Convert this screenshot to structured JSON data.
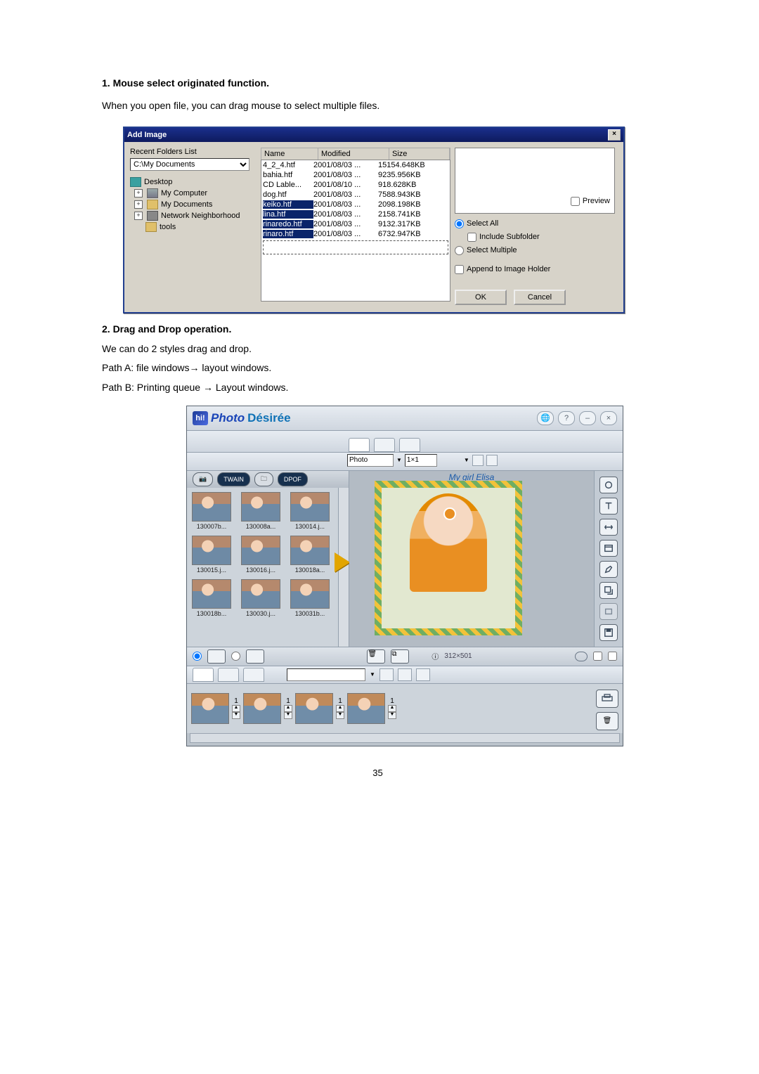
{
  "page_number": "35",
  "section1": {
    "heading": "1.  Mouse select originated function.",
    "para": "When you open file, you can drag mouse to select multiple files."
  },
  "dialog": {
    "title": "Add Image",
    "close": "×",
    "recent_label": "Recent Folders List",
    "recent_value": "C:\\My Documents",
    "tree": {
      "desktop": "Desktop",
      "mycomp": "My Computer",
      "mydocs": "My Documents",
      "netn": "Network Neighborhood",
      "tools": "tools"
    },
    "cols": {
      "name": "Name",
      "modified": "Modified",
      "size": "Size"
    },
    "files": [
      {
        "name": "4_2_4.htf",
        "mod": "2001/08/03 ...",
        "size": "15154.648KB",
        "sel": false
      },
      {
        "name": "bahia.htf",
        "mod": "2001/08/03 ...",
        "size": "9235.956KB",
        "sel": false
      },
      {
        "name": "CD Lable...",
        "mod": "2001/08/10 ...",
        "size": "918.628KB",
        "sel": false
      },
      {
        "name": "dog.htf",
        "mod": "2001/08/03 ...",
        "size": "7588.943KB",
        "sel": false
      },
      {
        "name": "keiko.htf",
        "mod": "2001/08/03 ...",
        "size": "2098.198KB",
        "sel": true
      },
      {
        "name": "lina.htf",
        "mod": "2001/08/03 ...",
        "size": "2158.741KB",
        "sel": true
      },
      {
        "name": "rinaredo.htf",
        "mod": "2001/08/03 ...",
        "size": "9132.317KB",
        "sel": true
      },
      {
        "name": "rinaro.htf",
        "mod": "2001/08/03 ...",
        "size": "6732.947KB",
        "sel": true
      }
    ],
    "preview": "Preview",
    "select_all": "Select All",
    "include_sub": "Include Subfolder",
    "select_multiple": "Select Multiple",
    "append": "Append to Image Holder",
    "ok": "OK",
    "cancel": "Cancel"
  },
  "section2": {
    "heading": "2.  Drag and Drop operation.",
    "p1": "We can do 2 styles drag and drop.",
    "p2": "Path A: file windows→ layout windows.",
    "p3": "Path B: Printing queue → Layout windows."
  },
  "app": {
    "brand_logo": "hi!",
    "brand1": "Photo",
    "brand2": "Désirée",
    "ctrl": {
      "globe": "🌐",
      "help": "?",
      "min": "–",
      "close": "×"
    },
    "tool": {
      "mode": "Photo",
      "layout": "1×1"
    },
    "sidetabs": {
      "cam": "📷",
      "twain": "TWAIN",
      "file": "🗀",
      "dpof": "DPOF"
    },
    "thumbs": [
      "130007b...",
      "130008a...",
      "130014.j...",
      "130015.j...",
      "130016.j...",
      "130018a...",
      "130018b...",
      "130030.j...",
      "130031b..."
    ],
    "canvas_caption": "My girl Elisa",
    "dim": "312×501",
    "queue_copies": [
      "1",
      "1",
      "1",
      "1"
    ]
  }
}
